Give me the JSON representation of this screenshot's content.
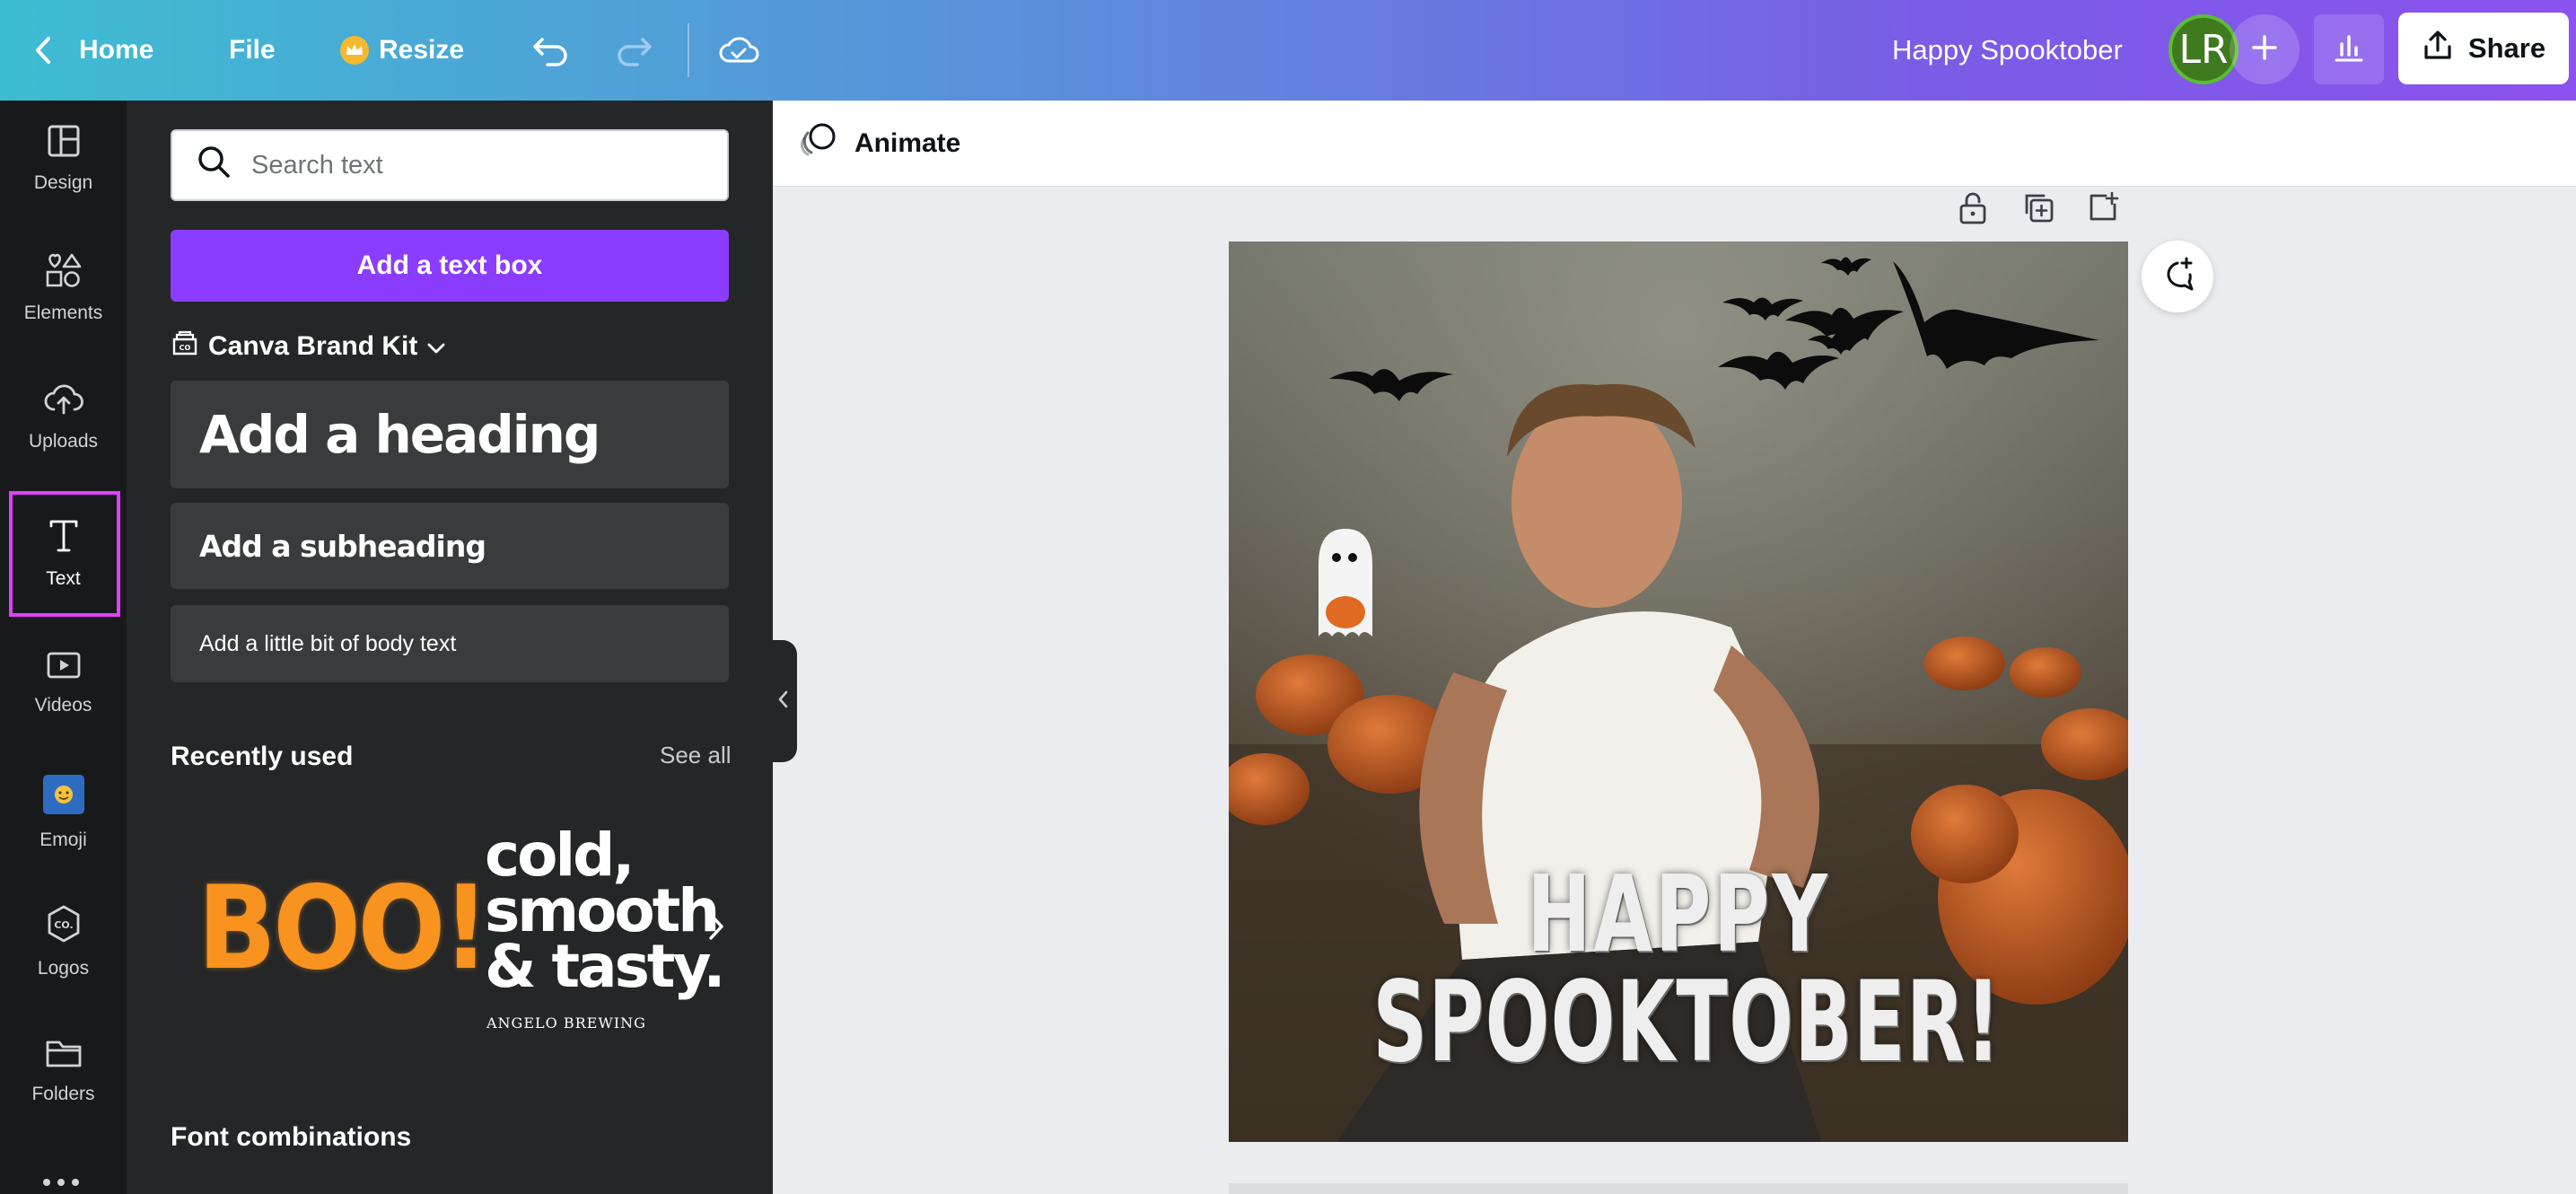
{
  "topbar": {
    "home_label": "Home",
    "file_label": "File",
    "resize_label": "Resize",
    "doc_title": "Happy Spooktober",
    "avatar_initials": "LR",
    "share_label": "Share",
    "gradient_start": "#3dbdd1",
    "gradient_end": "#8b52ef"
  },
  "rail": {
    "items": [
      {
        "label": "Design",
        "icon": "layout-icon"
      },
      {
        "label": "Elements",
        "icon": "shapes-icon"
      },
      {
        "label": "Uploads",
        "icon": "cloud-upload-icon"
      },
      {
        "label": "Text",
        "icon": "text-icon"
      },
      {
        "label": "Videos",
        "icon": "video-icon"
      },
      {
        "label": "Emoji",
        "icon": "emoji-icon"
      },
      {
        "label": "Logos",
        "icon": "logo-icon"
      },
      {
        "label": "Folders",
        "icon": "folder-icon"
      }
    ],
    "active": "Text"
  },
  "panel": {
    "search_placeholder": "Search text",
    "add_textbox_label": "Add a text box",
    "brand_kit_label": "Canva Brand Kit",
    "heading_label": "Add a heading",
    "subheading_label": "Add a subheading",
    "body_label": "Add a little bit of body text",
    "recently_used_label": "Recently used",
    "see_all_label": "See all",
    "recent_items": [
      {
        "text": "BOO!"
      },
      {
        "lines": [
          "cold,",
          "smooth",
          "& tasty."
        ],
        "caption": "ANGELO BREWING"
      }
    ],
    "font_combinations_label": "Font combinations",
    "accent_color": "#8b3dff"
  },
  "editor": {
    "animate_label": "Animate",
    "canvas_text": [
      "HAPPY",
      "SPOOKTOBER!"
    ]
  }
}
